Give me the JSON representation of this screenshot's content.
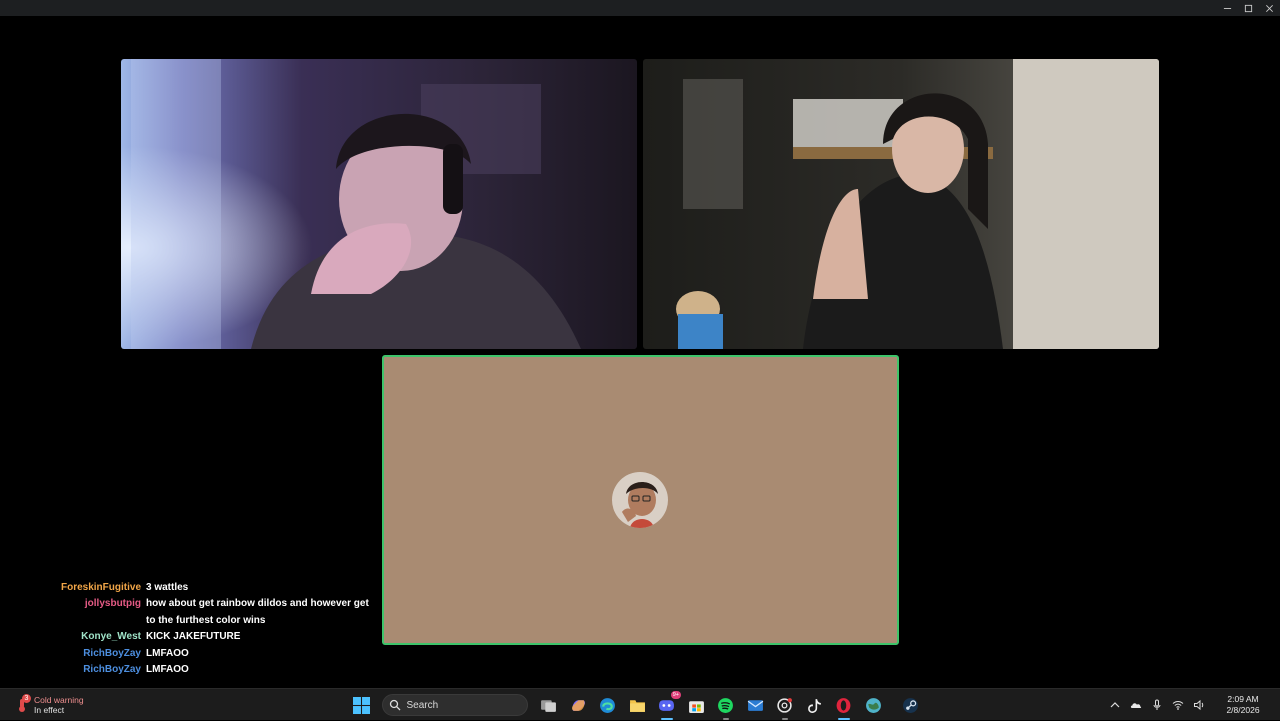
{
  "window": {
    "controls": [
      "minimize-icon",
      "maximize-icon",
      "close-icon"
    ]
  },
  "call": {
    "tiles": [
      {
        "name": "participant-1-video"
      },
      {
        "name": "participant-2-video"
      },
      {
        "name": "participant-3-avatar-tile",
        "background": "#a98b72",
        "active_speaker_border": "#3ec46a"
      }
    ]
  },
  "chat": {
    "messages": [
      {
        "user": "ForeskinFugitive",
        "color": "#f2a648",
        "text": "3 wattles"
      },
      {
        "user": "jollysbutpig",
        "color": "#e65b86",
        "text": "how about get rainbow dildos and however get to the furthest color wins"
      },
      {
        "user": "Konye_West",
        "color": "#9fe3c8",
        "text": "KICK JAKEFUTURE"
      },
      {
        "user": "RichBoyZay",
        "color": "#4d8fe0",
        "text": "LMFAOO"
      },
      {
        "user": "RichBoyZay",
        "color": "#4d8fe0",
        "text": "LMFAOO"
      }
    ]
  },
  "taskbar": {
    "weather": {
      "badge": "3",
      "title": "Cold warning",
      "subtitle": "In effect"
    },
    "search": {
      "placeholder": "Search"
    },
    "apps": [
      "start-icon",
      "search",
      "task-view-icon",
      "copilot-icon",
      "edge-icon",
      "file-explorer-icon",
      "discord-icon",
      "microsoft-store-icon",
      "spotify-icon",
      "mail-icon",
      "chatgpt-icon",
      "tiktok-icon",
      "opera-icon",
      "browser-globe-icon",
      "steam-icon"
    ],
    "discord_badge": "9+",
    "tray": [
      "chevron-up-icon",
      "onedrive-icon",
      "microphone-icon",
      "wifi-icon",
      "speaker-icon"
    ],
    "clock": {
      "time": "2:09 AM",
      "date": "2/8/2026"
    }
  }
}
